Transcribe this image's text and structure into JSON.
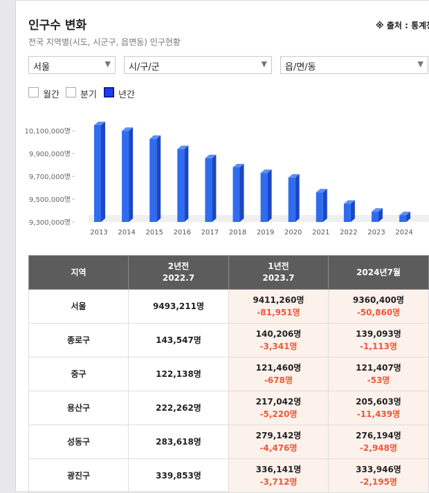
{
  "header": {
    "title": "인구수 변화",
    "source": "※ 출처 : 통계청",
    "subtitle": "전국 지역별(시도, 시군구, 읍면동) 인구현황"
  },
  "filters": {
    "sido": "서울",
    "sigungu": "시/구/군",
    "eupmyeondong": "읍/면/동"
  },
  "period_toggle": [
    {
      "label": "월간",
      "checked": false
    },
    {
      "label": "분기",
      "checked": false
    },
    {
      "label": "년간",
      "checked": true
    }
  ],
  "colors": {
    "bar_front": "#2f6cf0",
    "bar_side": "#1b47c4",
    "bar_top": "#5c8ff5",
    "decrease": "#f0573a",
    "highlight_bg": "#fdf1ec",
    "header_bg": "#5c5c5c"
  },
  "chart_data": {
    "type": "bar",
    "categories": [
      "2013",
      "2014",
      "2015",
      "2016",
      "2017",
      "2018",
      "2019",
      "2020",
      "2021",
      "2022",
      "2023",
      "2024"
    ],
    "values": [
      10150000,
      10100000,
      10030000,
      9940000,
      9860000,
      9780000,
      9730000,
      9690000,
      9560000,
      9460000,
      9390000,
      9360000
    ],
    "yticks": [
      "10,100,000명",
      "9,900,000명",
      "9,700,000명",
      "9,500,000명",
      "9,300,000명"
    ],
    "ylim": [
      9300000,
      10150000
    ]
  },
  "table": {
    "headers": [
      {
        "line1": "지역",
        "line2": ""
      },
      {
        "line1": "2년전",
        "line2": "2022.7"
      },
      {
        "line1": "1년전",
        "line2": "2023.7"
      },
      {
        "line1": "2024년7월",
        "line2": ""
      }
    ],
    "rows": [
      {
        "region": "서울",
        "two_years": "9493,211명",
        "one_year": "9411,260명",
        "one_year_diff": "-81,951명",
        "current": "9360,400명",
        "current_diff": "-50,860명"
      },
      {
        "region": "종로구",
        "two_years": "143,547명",
        "one_year": "140,206명",
        "one_year_diff": "-3,341명",
        "current": "139,093명",
        "current_diff": "-1,113명"
      },
      {
        "region": "중구",
        "two_years": "122,138명",
        "one_year": "121,460명",
        "one_year_diff": "-678명",
        "current": "121,407명",
        "current_diff": "-53명"
      },
      {
        "region": "용산구",
        "two_years": "222,262명",
        "one_year": "217,042명",
        "one_year_diff": "-5,220명",
        "current": "205,603명",
        "current_diff": "-11,439명"
      },
      {
        "region": "성동구",
        "two_years": "283,618명",
        "one_year": "279,142명",
        "one_year_diff": "-4,476명",
        "current": "276,194명",
        "current_diff": "-2,948명"
      },
      {
        "region": "광진구",
        "two_years": "339,853명",
        "one_year": "336,141명",
        "one_year_diff": "-3,712명",
        "current": "333,946명",
        "current_diff": "-2,195명"
      }
    ]
  }
}
